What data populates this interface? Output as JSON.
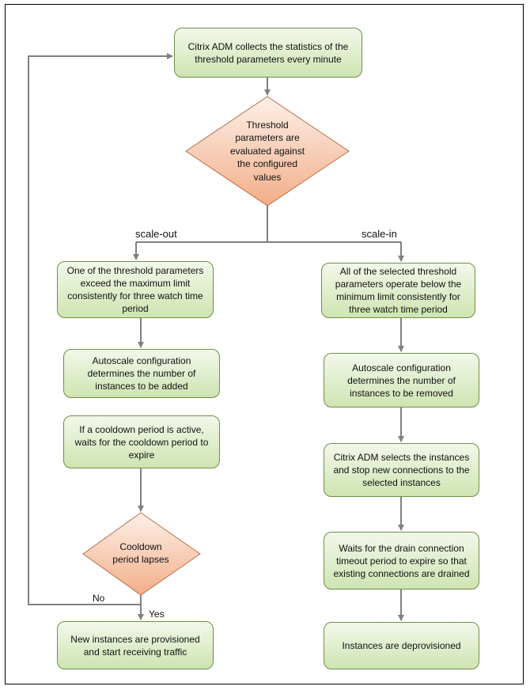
{
  "nodes": {
    "collect": "Citrix ADM collects the statistics of the threshold parameters  every minute",
    "evaluate": "Threshold parameters are evaluated against the configured values",
    "exceed": "One of the threshold parameters exceed the maximum limit consistently for three watch time period",
    "added": "Autoscale configuration determines the number of instances to be added",
    "cooldown_active": "If a cooldown period is active, waits for the cooldown period to expire",
    "cooldown_lapses": "Cooldown period lapses",
    "provisioned": "New instances are provisioned and start receiving traffic",
    "below": "All of the selected threshold parameters operate below the minimum limit consistently for three watch time period",
    "removed": "Autoscale configuration determines the number of instances to be removed",
    "select": "Citrix ADM selects the instances and stop new connections to the selected instances",
    "drain": "Waits for the drain connection timeout period to expire so that existing connections are drained",
    "deprovisioned": "Instances are deprovisioned"
  },
  "labels": {
    "scale_out": "scale-out",
    "scale_in": "scale-in",
    "no": "No",
    "yes": "Yes"
  },
  "colors": {
    "process_fill": "#d4e7b9",
    "process_border": "#6f8f48",
    "decision_fill": "#f4b896",
    "decision_border": "#b7704a",
    "connector": "#808080"
  }
}
